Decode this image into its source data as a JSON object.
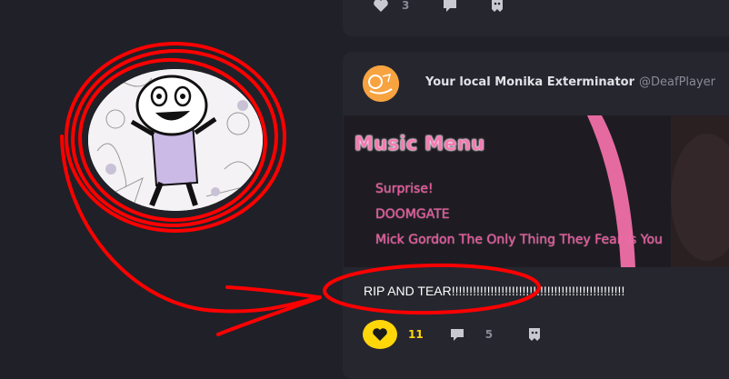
{
  "previous_post": {
    "like_count": "3"
  },
  "post": {
    "display_name": "Your local Monika Exterminator",
    "handle": "@DeafPlayer",
    "media": {
      "title": "Music Menu",
      "tracks": [
        "Surprise!",
        "DOOMGATE",
        "Mick Gordon  The Only Thing They Fear Is You"
      ]
    },
    "text": "RIP AND TEAR!!!!!!!!!!!!!!!!!!!!!!!!!!!!!!!!!!!!!!!!!!!!!!!!!",
    "like_count": "11",
    "comment_count": "5"
  },
  "icons": {
    "like": "heart-icon",
    "comment": "speech-bubble-icon",
    "share": "share-ghost-icon"
  },
  "colors": {
    "background": "#202028",
    "card": "#26262f",
    "liked": "#ffd60a",
    "annotation": "#ff0000",
    "pink_text": "#e6559a"
  }
}
